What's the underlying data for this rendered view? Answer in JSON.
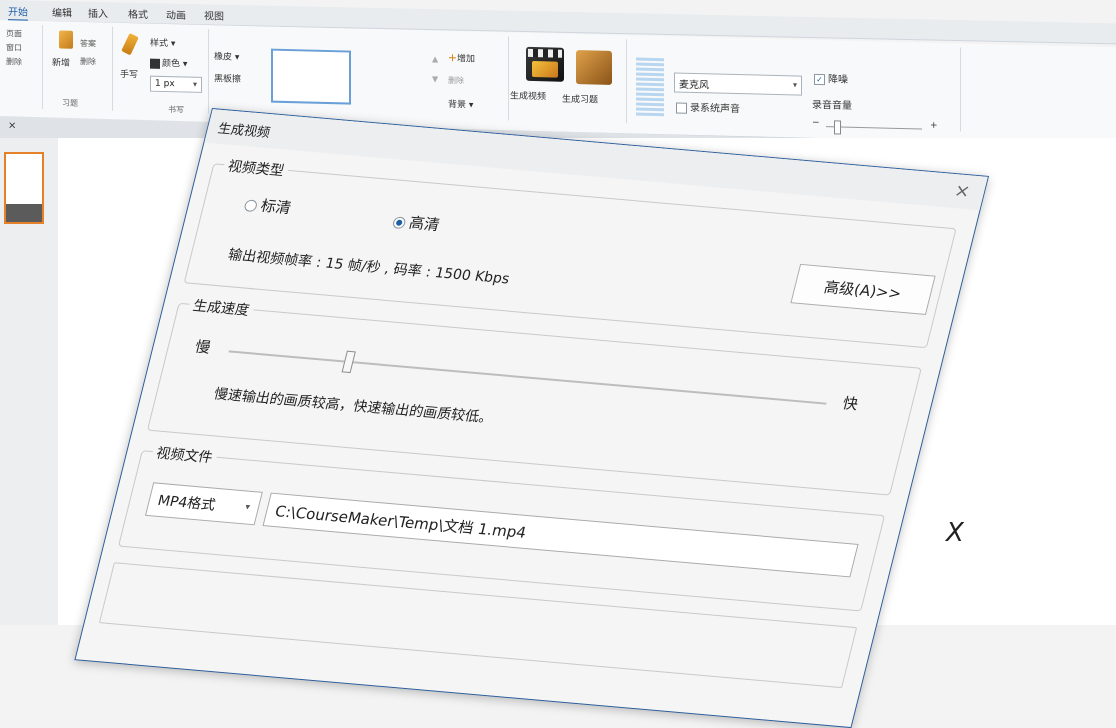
{
  "tabs": [
    "开始",
    "编辑",
    "插入",
    "格式",
    "动画",
    "视图"
  ],
  "ribbon": {
    "left_group": {
      "items": [
        "页面",
        "窗口",
        "删除"
      ]
    },
    "exercise_group": {
      "new_label": "新增",
      "item1": "答案",
      "delete_label": "删除",
      "label": "习题"
    },
    "writing_group": {
      "handwrite_label": "手写",
      "style_label": "样式",
      "color_label": "颜色",
      "width_value": "1",
      "width_unit": "px",
      "label": "书写"
    },
    "eraser_group": {
      "eraser_label": "橡皮",
      "blackboard_label": "黑板擦"
    },
    "page_group": {
      "add_label": "增加",
      "delete_label": "删除",
      "background_label": "背景"
    },
    "video_group": {
      "generate_video_label": "生成视频",
      "generate_exercise_label": "生成习题"
    },
    "audio_group": {
      "mic_value": "麦克风",
      "record_system_label": "录系统声音",
      "denoise_label": "降噪",
      "volume_label": "录音音量",
      "minus": "−",
      "plus": "+"
    }
  },
  "doc": {
    "close_glyph": "×",
    "canvas_text": "X"
  },
  "dialog": {
    "title": "生成视频",
    "close_glyph": "×",
    "video_type": {
      "legend": "视频类型",
      "sd_label": "标清",
      "hd_label": "高清",
      "selected": "高清",
      "info": "输出视频帧率 : 15 帧/秒 , 码率 : 1500 Kbps",
      "advanced_label": "高级(A)>>"
    },
    "speed": {
      "legend": "生成速度",
      "slow_label": "慢",
      "fast_label": "快",
      "hint": "慢速输出的画质较高，快速输出的画质较低。",
      "position": 0.2
    },
    "file": {
      "legend": "视频文件",
      "format_value": "MP4格式",
      "path_value": "C:\\CourseMaker\\Temp\\文档 1.mp4"
    }
  },
  "colors": {
    "accent": "#1f5fa8",
    "thumb_border": "#e4812b"
  }
}
